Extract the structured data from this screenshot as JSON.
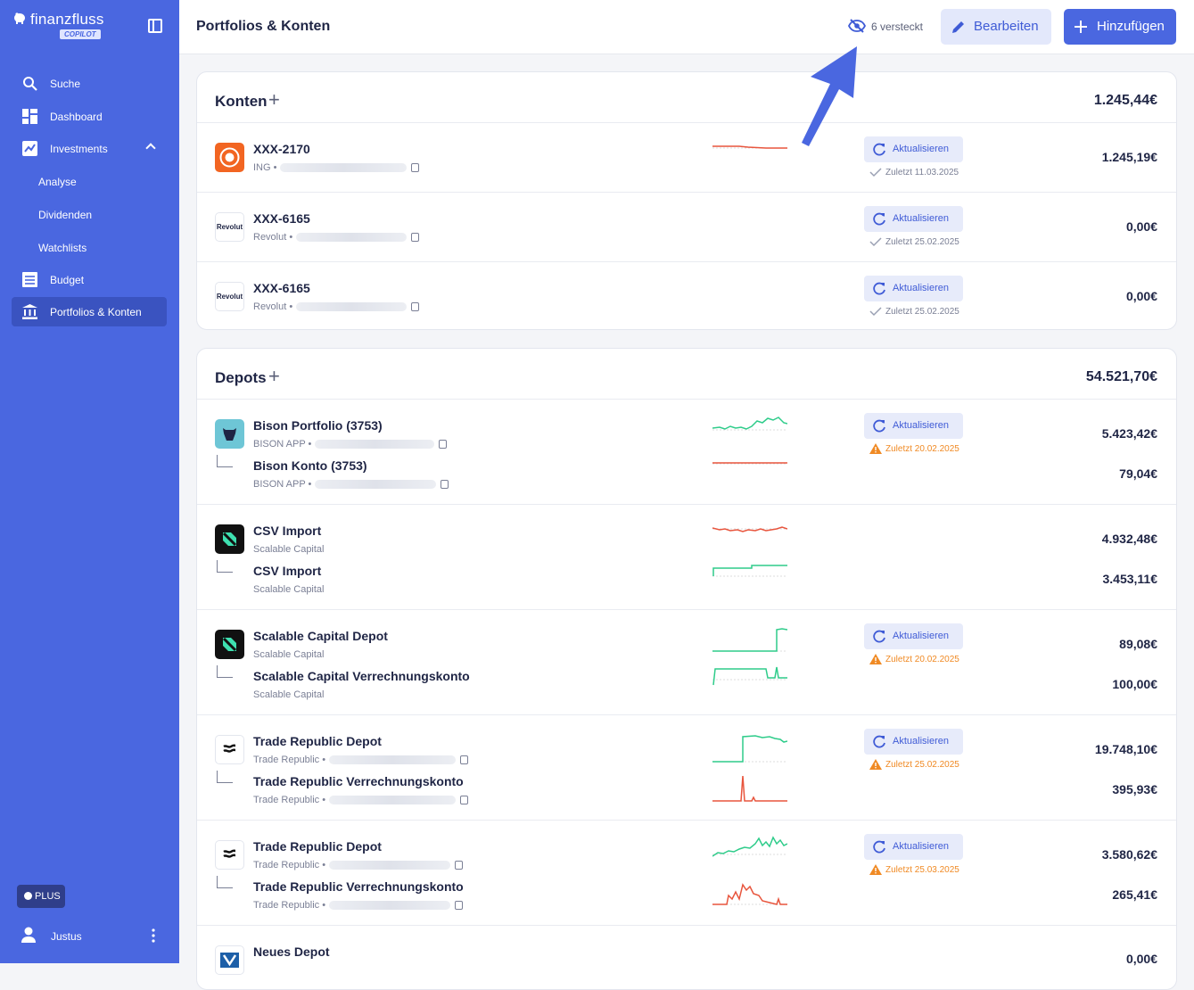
{
  "app": {
    "brand": "finanzfluss",
    "badge": "COPILOT"
  },
  "sidebar": {
    "items": [
      {
        "label": "Suche",
        "icon": "search-icon"
      },
      {
        "label": "Dashboard",
        "icon": "dashboard-icon"
      },
      {
        "label": "Investments",
        "icon": "chart-icon"
      },
      {
        "label": "Analyse"
      },
      {
        "label": "Dividenden"
      },
      {
        "label": "Watchlists"
      },
      {
        "label": "Budget",
        "icon": "budget-icon"
      },
      {
        "label": "Portfolios & Konten",
        "icon": "bank-icon"
      }
    ],
    "plus_label": "PLUS",
    "user": "Justus"
  },
  "header": {
    "title": "Portfolios & Konten",
    "hidden_count": "6 versteckt",
    "edit_label": "Bearbeiten",
    "add_label": "Hinzufügen"
  },
  "update_label": "Aktualisieren",
  "konten": {
    "title": "Konten",
    "total": "1.245,44€",
    "rows": [
      {
        "name": "XXX-2170",
        "sub": "ING •",
        "amount": "1.245,19€",
        "status": "Zuletzt 11.03.2025"
      },
      {
        "name": "XXX-6165",
        "sub": "Revolut •",
        "amount": "0,00€",
        "status": "Zuletzt 25.02.2025"
      },
      {
        "name": "XXX-6165",
        "sub": "Revolut •",
        "amount": "0,00€",
        "status": "Zuletzt 25.02.2025"
      }
    ],
    "logo_text": [
      "Revolut",
      "Revolut"
    ]
  },
  "depots": {
    "title": "Depots",
    "total": "54.521,70€",
    "groups": [
      {
        "a_name": "Bison Portfolio (3753)",
        "a_sub": "BISON APP •",
        "a_amount": "5.423,42€",
        "b_name": "Bison Konto (3753)",
        "b_sub": "BISON APP •",
        "b_amount": "79,04€",
        "status": "Zuletzt 20.02.2025"
      },
      {
        "a_name": "CSV Import",
        "a_sub": "Scalable Capital",
        "a_amount": "4.932,48€",
        "b_name": "CSV Import",
        "b_sub": "Scalable Capital",
        "b_amount": "3.453,11€"
      },
      {
        "a_name": "Scalable Capital Depot",
        "a_sub": "Scalable Capital",
        "a_amount": "89,08€",
        "b_name": "Scalable Capital Verrechnungskonto",
        "b_sub": "Scalable Capital",
        "b_amount": "100,00€",
        "status": "Zuletzt 20.02.2025"
      },
      {
        "a_name": "Trade Republic Depot",
        "a_sub": "Trade Republic •",
        "a_amount": "19.748,10€",
        "b_name": "Trade Republic Verrechnungskonto",
        "b_sub": "Trade Republic •",
        "b_amount": "395,93€",
        "status": "Zuletzt 25.02.2025"
      },
      {
        "a_name": "Trade Republic Depot",
        "a_sub": "Trade Republic •",
        "a_amount": "3.580,62€",
        "b_name": "Trade Republic Verrechnungskonto",
        "b_sub": "Trade Republic •",
        "b_amount": "265,41€",
        "status": "Zuletzt 25.03.2025"
      },
      {
        "a_name": "Neues Depot",
        "a_amount": "0,00€"
      }
    ]
  },
  "colors": {
    "accent": "#4a67e0",
    "positive": "#2ecc8a",
    "negative": "#e8553d",
    "warning": "#f08a24"
  }
}
